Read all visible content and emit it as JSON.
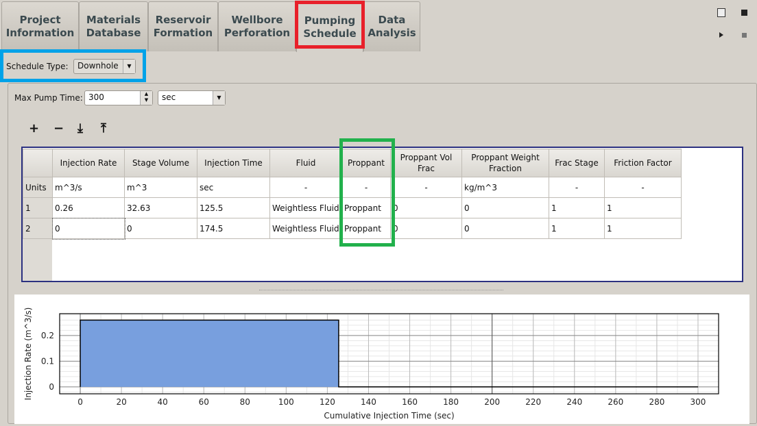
{
  "tabs": [
    {
      "label": "Project\nInformation"
    },
    {
      "label": "Materials\nDatabase"
    },
    {
      "label": "Reservoir\nFormation"
    },
    {
      "label": "Wellbore\nPerforation"
    },
    {
      "label": "Pumping\nSchedule",
      "active": true
    },
    {
      "label": "Data\nAnalysis"
    }
  ],
  "toolbar_icons": [
    "new-file-icon",
    "save-icon",
    "run-icon",
    "stop-icon"
  ],
  "schedule_type": {
    "label": "Schedule Type:",
    "value": "Downhole"
  },
  "max_pump": {
    "label": "Max Pump Time:",
    "value": "300",
    "unit": "sec"
  },
  "table_actions": [
    {
      "icon": "add-icon",
      "glyph": "+"
    },
    {
      "icon": "remove-icon",
      "glyph": "−"
    },
    {
      "icon": "import-icon",
      "glyph": "⤓"
    },
    {
      "icon": "export-icon",
      "glyph": "⤒"
    }
  ],
  "table": {
    "columns": [
      "Injection Rate",
      "Stage Volume",
      "Injection Time",
      "Fluid",
      "Proppant",
      "Proppant Vol Frac",
      "Proppant Weight Fraction",
      "Frac Stage",
      "Friction Factor"
    ],
    "rows": [
      {
        "header": "Units",
        "cells": [
          "m^3/s",
          "m^3",
          "sec",
          "-",
          "-",
          "-",
          "kg/m^3",
          "-",
          "-"
        ]
      },
      {
        "header": "1",
        "cells": [
          "0.26",
          "32.63",
          "125.5",
          "Weightless Fluid",
          "Proppant",
          "0",
          "0",
          "1",
          "1"
        ]
      },
      {
        "header": "2",
        "cells": [
          "0",
          "0",
          "174.5",
          "Weightless Fluid",
          "Proppant",
          "0",
          "0",
          "1",
          "1"
        ]
      }
    ]
  },
  "highlights": {
    "red": "#e8202a",
    "blue": "#00a2e8",
    "green": "#22b14c"
  },
  "chart_data": {
    "type": "area",
    "xlabel": "Cumulative Injection Time (sec)",
    "ylabel": "Injection Rate (m^3/s)",
    "xlim": [
      -10,
      310
    ],
    "ylim": [
      -0.027,
      0.285
    ],
    "xticks": [
      0,
      20,
      40,
      60,
      80,
      100,
      120,
      140,
      160,
      180,
      200,
      220,
      240,
      260,
      280,
      300
    ],
    "yticks": [
      0,
      0.1,
      0.2
    ],
    "steps": [
      {
        "start": 0,
        "end": 125.5,
        "value": 0.26
      },
      {
        "start": 125.5,
        "end": 300,
        "value": 0
      }
    ],
    "fill_color": "#789fde",
    "grid": true
  }
}
